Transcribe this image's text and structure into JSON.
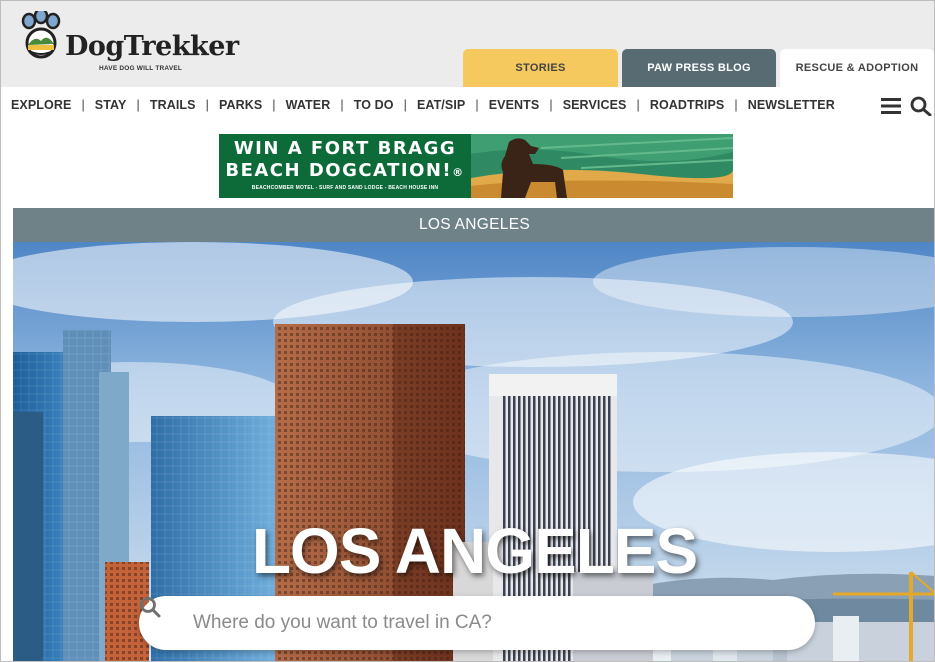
{
  "brand": {
    "name": "DogTrekker",
    "tagline": "HAVE DOG WILL TRAVEL",
    "trademark": "®",
    "colors": {
      "header_bg": "#ececec",
      "paw_blue": "#7fa7cf",
      "accent_yellow": "#f5c95d",
      "slate": "#586b73"
    }
  },
  "tabs": [
    {
      "label": "STORIES"
    },
    {
      "label": "PAW PRESS BLOG"
    },
    {
      "label": "RESCUE & ADOPTION"
    }
  ],
  "nav": {
    "items": [
      "EXPLORE",
      "STAY",
      "TRAILS",
      "PARKS",
      "WATER",
      "TO DO",
      "EAT/SIP",
      "EVENTS",
      "SERVICES",
      "ROADTRIPS",
      "NEWSLETTER"
    ],
    "separator": "|",
    "icons": [
      "hamburger-menu-icon",
      "search-icon"
    ]
  },
  "ad": {
    "line1": "WIN A FORT BRAGG",
    "line2": "BEACH DOGCATION!",
    "registered": "®",
    "fineprint": "BEACHCOMBER MOTEL - SURF AND SAND LODGE - BEACH HOUSE INN",
    "colors": {
      "panel": "#0d6b3a",
      "sky": "#2f8a63",
      "sand": "#e1a94a"
    }
  },
  "location_bar": {
    "label": "LOS ANGELES",
    "color": "#6e8288"
  },
  "hero": {
    "title": "LOS ANGELES",
    "search": {
      "placeholder": "Where do you want to travel in CA?",
      "value": ""
    }
  }
}
